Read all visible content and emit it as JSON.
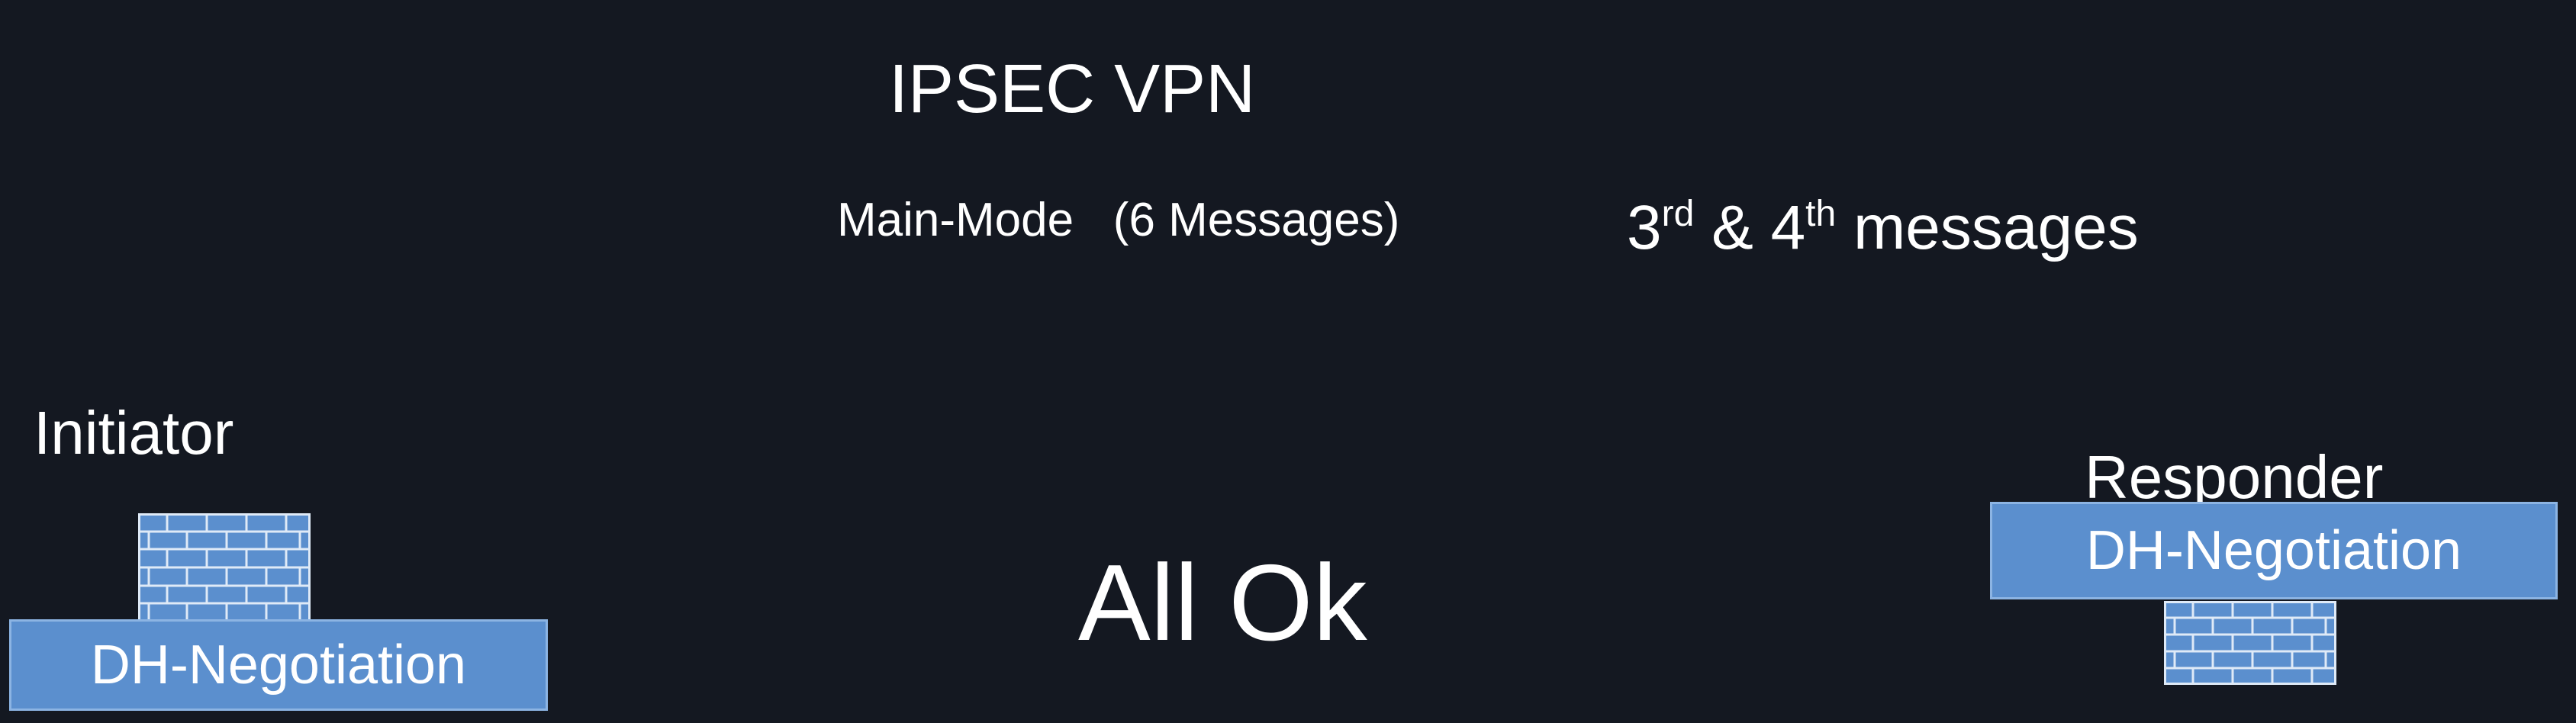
{
  "title": "IPSEC VPN",
  "mode": "Main-Mode   (6 Messages)",
  "messages": {
    "first_num": "3",
    "first_sup": "rd",
    "amp": " & ",
    "second_num": "4",
    "second_sup": "th",
    "suffix": " messages"
  },
  "initiator": {
    "label": "Initiator",
    "box_label": "DH-Negotiation"
  },
  "responder": {
    "label": "Responder",
    "box_label": "DH-Negotiation"
  },
  "status": "All Ok",
  "colors": {
    "background": "#141821",
    "box_fill": "#5b8fce",
    "box_border": "#8cb4e3",
    "firewall_fill": "#5b8fce",
    "firewall_mortar": "#dfeaf7"
  },
  "icons": [
    "firewall-icon",
    "firewall-icon"
  ]
}
